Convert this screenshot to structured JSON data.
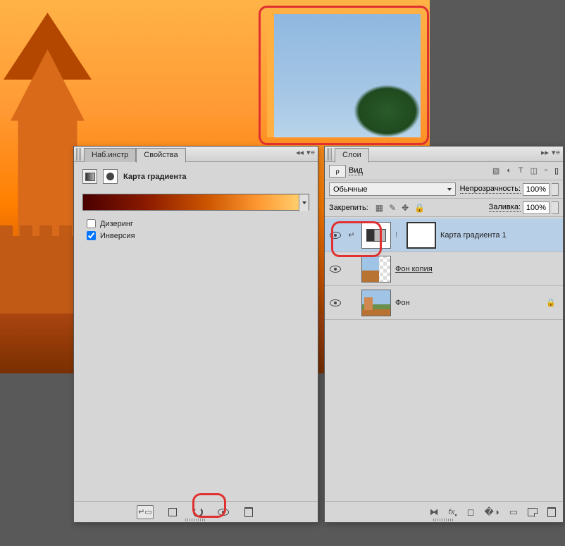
{
  "properties_panel": {
    "tabs": {
      "presets": "Наб.инстр",
      "properties": "Свойства"
    },
    "title": "Карта градиента",
    "dither_label": "Дизеринг",
    "reverse_label": "Инверсия",
    "dither_checked": false,
    "reverse_checked": true
  },
  "layers_panel": {
    "tab": "Слои",
    "kind_label": "Вид",
    "blend_mode": "Обычные",
    "opacity_label": "Непрозрачность:",
    "opacity_value": "100%",
    "lock_label": "Закрепить:",
    "fill_label": "Заливка:",
    "fill_value": "100%",
    "layers": [
      {
        "name": "Карта градиента 1",
        "selected": true,
        "clipped": true,
        "visible": true
      },
      {
        "name": "Фон копия",
        "selected": false,
        "underlined": true,
        "visible": true
      },
      {
        "name": "Фон",
        "selected": false,
        "locked": true,
        "visible": true
      }
    ]
  }
}
